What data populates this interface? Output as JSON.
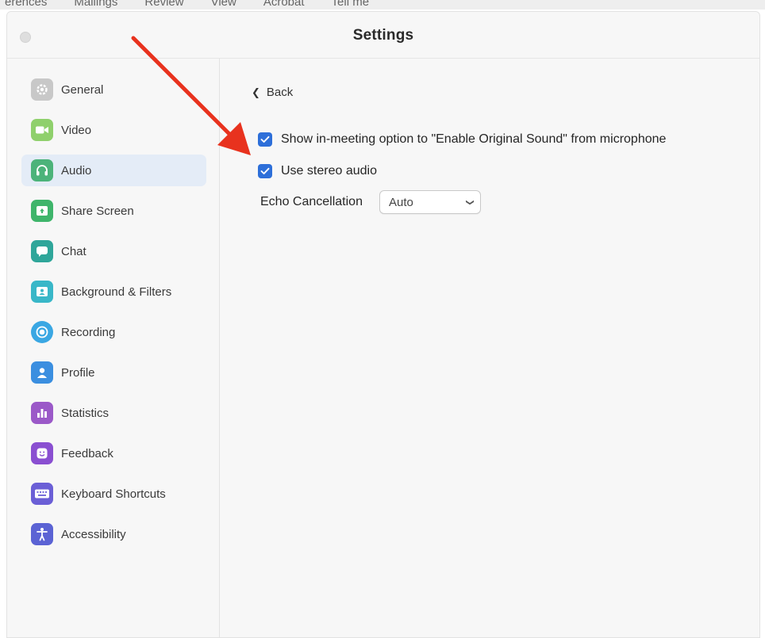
{
  "menubar": {
    "items": [
      "erences",
      "Mailings",
      "Review",
      "View",
      "Acrobat",
      "Tell me"
    ]
  },
  "window": {
    "title": "Settings"
  },
  "sidebar": {
    "active_index": 2,
    "items": [
      {
        "label": "General",
        "icon": "gear-icon",
        "color": "#c8c8c8"
      },
      {
        "label": "Video",
        "icon": "video-camera-icon",
        "color": "#8fd06c"
      },
      {
        "label": "Audio",
        "icon": "headphones-icon",
        "color": "#4cb37a"
      },
      {
        "label": "Share Screen",
        "icon": "share-screen-icon",
        "color": "#3fb56b"
      },
      {
        "label": "Chat",
        "icon": "chat-bubble-icon",
        "color": "#2fa69a"
      },
      {
        "label": "Background & Filters",
        "icon": "background-person-icon",
        "color": "#39b7c8"
      },
      {
        "label": "Recording",
        "icon": "record-icon",
        "color": "#3aa7e3"
      },
      {
        "label": "Profile",
        "icon": "person-icon",
        "color": "#3b8fe0"
      },
      {
        "label": "Statistics",
        "icon": "bar-chart-icon",
        "color": "#9b59c8"
      },
      {
        "label": "Feedback",
        "icon": "smiley-icon",
        "color": "#8a4fd1"
      },
      {
        "label": "Keyboard Shortcuts",
        "icon": "keyboard-icon",
        "color": "#6b5fd6"
      },
      {
        "label": "Accessibility",
        "icon": "accessibility-icon",
        "color": "#5b63d4"
      }
    ]
  },
  "content": {
    "back_label": "Back",
    "options": [
      {
        "label": "Show in-meeting option to \"Enable Original Sound\" from microphone",
        "checked": true
      },
      {
        "label": "Use stereo audio",
        "checked": true
      }
    ],
    "echo_cancellation": {
      "label": "Echo Cancellation",
      "value": "Auto"
    }
  },
  "colors": {
    "accent": "#2d6fd9",
    "active_item_bg": "#e4ecf7",
    "annotation_arrow": "#e8321e"
  }
}
